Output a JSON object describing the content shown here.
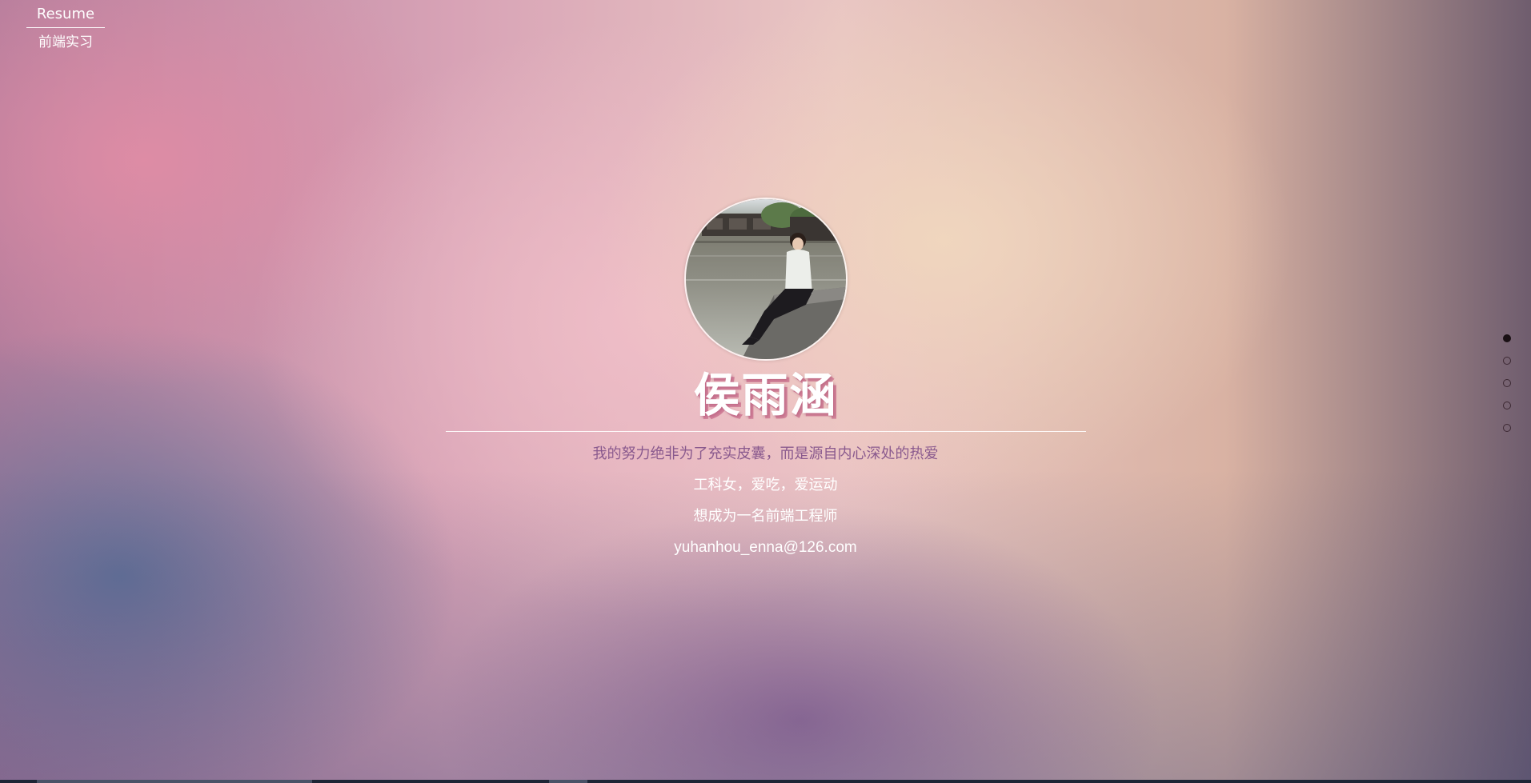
{
  "nav": {
    "items": [
      {
        "label": "Resume"
      },
      {
        "label": "前端实习"
      }
    ]
  },
  "profile": {
    "name": "侯雨涵",
    "motto": "我的努力绝非为了充实皮囊，而是源自内心深处的热爱",
    "line1": "工科女，爱吃，爱运动",
    "line2": "想成为一名前端工程师",
    "email": "yuhanhou_enna@126.com"
  },
  "pagination": {
    "count": 5,
    "active_index": 0
  },
  "colors": {
    "motto": "#8a5a8e",
    "name_shadow": "#be5078",
    "dot_active": "#1a1014"
  }
}
